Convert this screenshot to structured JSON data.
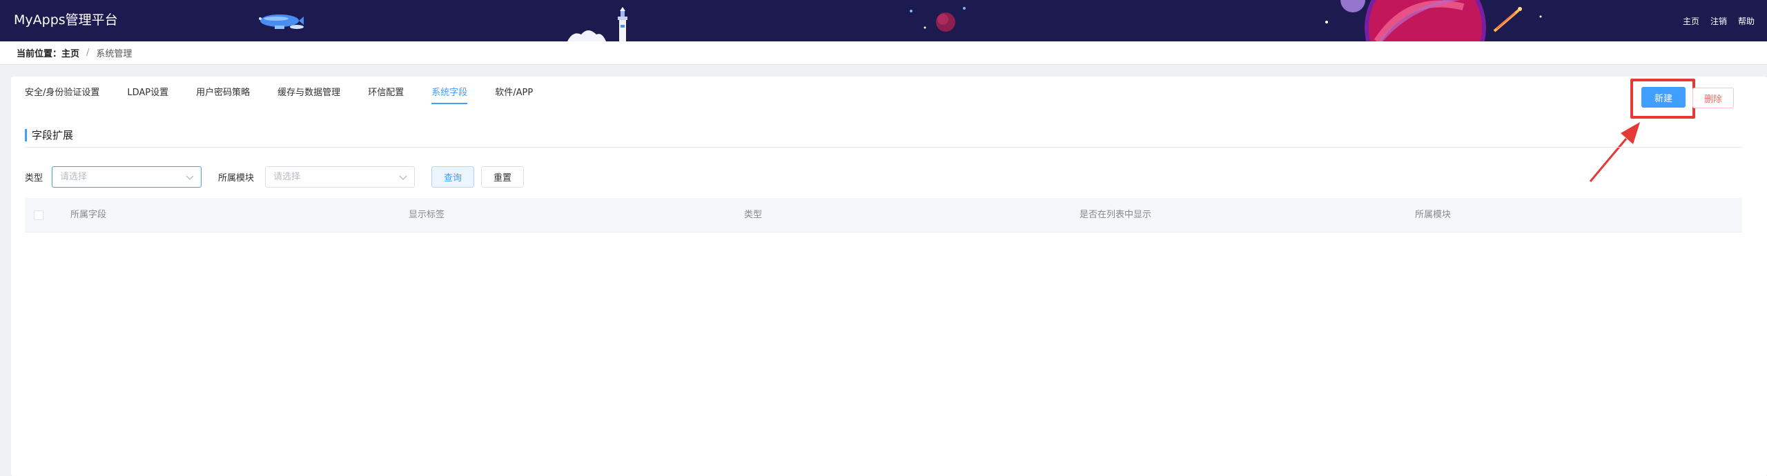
{
  "header": {
    "title": "MyApps管理平台",
    "links": [
      "主页",
      "注销",
      "帮助"
    ]
  },
  "breadcrumb": {
    "label": "当前位置：",
    "home": "主页",
    "separator": "/",
    "current": "系统管理"
  },
  "tabs": [
    "安全/身份验证设置",
    "LDAP设置",
    "用户密码策略",
    "缓存与数据管理",
    "环信配置",
    "系统字段",
    "软件/APP"
  ],
  "active_tab": "系统字段",
  "actions": {
    "new_label": "新建",
    "delete_label": "删除"
  },
  "section": {
    "title": "字段扩展"
  },
  "filters": {
    "type_label": "类型",
    "type_placeholder": "请选择",
    "module_label": "所属模块",
    "module_placeholder": "请选择",
    "query_label": "查询",
    "reset_label": "重置"
  },
  "table": {
    "columns": [
      "所属字段",
      "显示标签",
      "类型",
      "是否在列表中显示",
      "所属模块"
    ],
    "rows": []
  },
  "colors": {
    "header_bg": "#1d1a4f",
    "accent": "#409eff",
    "danger": "#f56c6c",
    "annotation": "#e53935"
  },
  "icons": [
    "chevron-down-icon",
    "annotation-arrow-icon",
    "header-decoration-icon"
  ]
}
